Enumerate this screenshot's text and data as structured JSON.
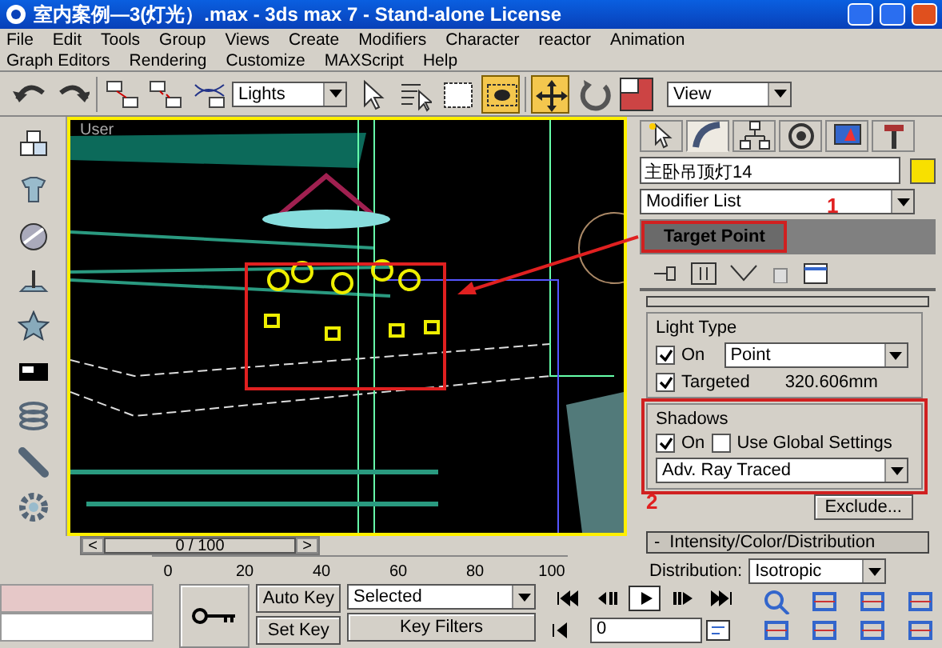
{
  "window": {
    "title": "室内案例—3(灯光）.max  -  3ds max 7  -  Stand-alone License"
  },
  "menu_rows": [
    [
      "File",
      "Edit",
      "Tools",
      "Group",
      "Views",
      "Create",
      "Modifiers",
      "Character",
      "reactor",
      "Animation"
    ],
    [
      "Graph Editors",
      "Rendering",
      "Customize",
      "MAXScript",
      "Help"
    ]
  ],
  "toolbar": {
    "tools": [
      {
        "kind": "undo",
        "selected": false
      },
      {
        "kind": "redo",
        "selected": false
      },
      {
        "kind": "sep"
      },
      {
        "kind": "link",
        "selected": false
      },
      {
        "kind": "unlink",
        "selected": false
      },
      {
        "kind": "bind",
        "selected": false
      },
      {
        "kind": "filter"
      },
      {
        "kind": "arrow",
        "selected": false
      },
      {
        "kind": "byname",
        "selected": false
      },
      {
        "kind": "region",
        "selected": false
      },
      {
        "kind": "crossing",
        "selected": true
      },
      {
        "kind": "sep"
      },
      {
        "kind": "move",
        "selected": true
      },
      {
        "kind": "rotate",
        "selected": false
      },
      {
        "kind": "scale",
        "selected": false
      },
      {
        "kind": "coords"
      }
    ],
    "selection_filter": "Lights",
    "reference_coordinate": "View"
  },
  "viewport": {
    "label": "User",
    "active": true
  },
  "command_panel": {
    "tabs": [
      {
        "kind": "create",
        "selected": false
      },
      {
        "kind": "modify",
        "selected": true
      },
      {
        "kind": "hierarchy",
        "selected": false
      },
      {
        "kind": "motion",
        "selected": false
      },
      {
        "kind": "display",
        "selected": false
      },
      {
        "kind": "utilities",
        "selected": false
      }
    ],
    "object_name": "主卧吊顶灯14",
    "modifier_list": "Modifier List",
    "stack": [
      {
        "label": "Target Point",
        "selected": true,
        "highlighted": true
      }
    ],
    "light_type": {
      "title": "Light Type",
      "on": {
        "label": "On",
        "checked": true
      },
      "type": "Point",
      "targeted": {
        "label": "Targeted",
        "checked": true
      },
      "distance": "320.606mm"
    },
    "shadows": {
      "title": "Shadows",
      "highlighted": true,
      "on": {
        "label": "On",
        "checked": true
      },
      "global": {
        "label": "Use Global Settings",
        "checked": false
      },
      "type": "Adv. Ray Traced",
      "exclude": "Exclude..."
    },
    "intensity": {
      "toggle": "-",
      "title": "Intensity/Color/Distribution",
      "distribution_label": "Distribution:",
      "distribution": "Isotropic"
    }
  },
  "annotations": [
    "1",
    "2"
  ],
  "timeline": {
    "position": "0 / 100",
    "prev": "<",
    "next": ">",
    "ticks": [
      "0",
      "20",
      "40",
      "60",
      "80",
      "100"
    ]
  },
  "animation": {
    "auto_key": "Auto Key",
    "auto_key_on": false,
    "key_filter": "Selected",
    "set_key": "Set Key",
    "key_filters": "Key Filters",
    "frame": "0"
  },
  "playback": [
    {
      "kind": "start",
      "selected": false
    },
    {
      "kind": "prev",
      "selected": false
    },
    {
      "kind": "play",
      "selected": true
    },
    {
      "kind": "next",
      "selected": false
    },
    {
      "kind": "end",
      "selected": false
    }
  ]
}
